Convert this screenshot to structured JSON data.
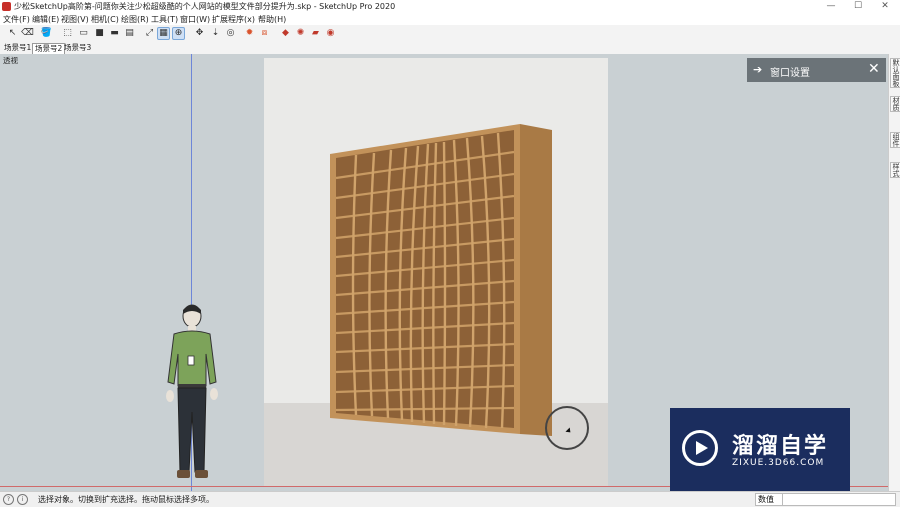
{
  "window": {
    "title": "少松SketchUp高阶第-问题你关注少松超级酷的个人网站的模型文件部分提升为.skp - SketchUp Pro 2020",
    "minimize": "—",
    "maximize": "☐",
    "close": "✕"
  },
  "menu": [
    "文件(F)",
    "编辑(E)",
    "视图(V)",
    "相机(C)",
    "绘图(R)",
    "工具(T)",
    "窗口(W)",
    "扩展程序(x)",
    "帮助(H)"
  ],
  "toolbar": [
    {
      "icon": "select-icon",
      "glyph": "↖"
    },
    {
      "icon": "eraser-icon",
      "glyph": "⌫"
    },
    {
      "icon": "paint-bucket-icon",
      "glyph": "🪣"
    },
    {
      "icon": "iso-view-icon",
      "glyph": "⬚"
    },
    {
      "icon": "top-view-icon",
      "glyph": "▭"
    },
    {
      "icon": "front-view-icon",
      "glyph": "■"
    },
    {
      "icon": "right-view-icon",
      "glyph": "▬"
    },
    {
      "icon": "back-view-icon",
      "glyph": "▤"
    },
    {
      "icon": "section-plane-icon",
      "glyph": "⤢"
    },
    {
      "icon": "scenes-icon",
      "glyph": "▦"
    },
    {
      "icon": "orbit-icon",
      "glyph": "⊕"
    },
    {
      "icon": "pan-icon",
      "glyph": "✥"
    },
    {
      "icon": "walk-icon",
      "glyph": "⇣"
    },
    {
      "icon": "look-around-icon",
      "glyph": "◎"
    },
    {
      "icon": "sun-icon",
      "glyph": "✹"
    },
    {
      "icon": "shadow-icon",
      "glyph": "⧈"
    },
    {
      "icon": "ruby-icon",
      "glyph": "◆"
    },
    {
      "icon": "gear-red-icon",
      "glyph": "✺"
    },
    {
      "icon": "folder-icon",
      "glyph": "▰"
    },
    {
      "icon": "render-icon",
      "glyph": "◉"
    }
  ],
  "scene_tabs": [
    "场景号1",
    "场景号2",
    "场景号3"
  ],
  "viewport": {
    "camera_label": "透视"
  },
  "tray": {
    "arrow": "➔",
    "title": "窗口设置",
    "close": "✕"
  },
  "right_tabs": [
    "默认面板",
    "材质",
    "组件",
    "样式"
  ],
  "watermark": {
    "brand": "溜溜自学",
    "url": "ZIXUE.3D66.COM"
  },
  "status": {
    "message": "选择对象。切换到扩充选择。拖动鼠标选择多项。",
    "measure_label": "数值",
    "measure_value": ""
  },
  "colors": {
    "viewport_bg": "#c9d0d3",
    "tray_bg": "#6b7378",
    "shelf_wood": "#b5854f",
    "watermark_bg": "#1b2d5e"
  }
}
